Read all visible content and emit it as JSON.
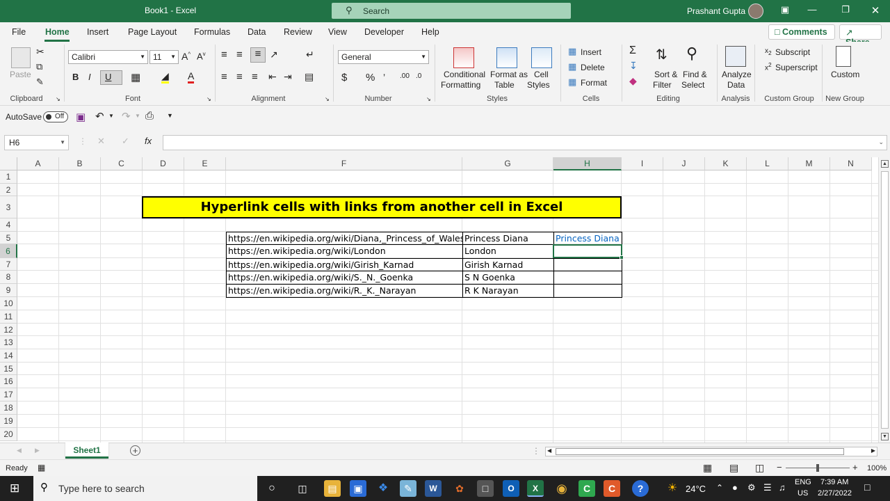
{
  "window": {
    "title": "Book1 - Excel",
    "search_label": "Search",
    "user_name": "Prashant Gupta"
  },
  "menu": {
    "items": [
      "File",
      "Home",
      "Insert",
      "Page Layout",
      "Formulas",
      "Data",
      "Review",
      "View",
      "Developer",
      "Help"
    ],
    "active": "Home",
    "comments": "Comments",
    "share": "Share"
  },
  "ribbon": {
    "clipboard": {
      "label": "Clipboard",
      "paste": "Paste"
    },
    "font": {
      "label": "Font",
      "name": "Calibri",
      "size": "11",
      "bold": "B",
      "italic": "I",
      "underline": "U"
    },
    "alignment": {
      "label": "Alignment"
    },
    "number": {
      "label": "Number",
      "format": "General"
    },
    "styles": {
      "label": "Styles",
      "cond1": "Conditional",
      "cond2": "Formatting",
      "fmt1": "Format as",
      "fmt2": "Table",
      "cell1": "Cell",
      "cell2": "Styles"
    },
    "cells": {
      "label": "Cells",
      "insert": "Insert",
      "delete": "Delete",
      "format": "Format"
    },
    "editing": {
      "label": "Editing",
      "sort1": "Sort &",
      "sort2": "Filter",
      "find1": "Find &",
      "find2": "Select"
    },
    "analysis": {
      "label": "Analysis",
      "analyze1": "Analyze",
      "analyze2": "Data"
    },
    "custom_group": {
      "label": "Custom Group",
      "subscript": "Subscript",
      "superscript": "Superscript"
    },
    "new_group": {
      "label": "New Group",
      "custom": "Custom"
    }
  },
  "qat": {
    "autosave": "AutoSave",
    "toggle": "Off"
  },
  "formula_bar": {
    "name_box": "H6",
    "formula": ""
  },
  "sheet": {
    "columns": [
      "A",
      "B",
      "C",
      "D",
      "E",
      "F",
      "G",
      "H",
      "I",
      "J",
      "K",
      "L",
      "M",
      "N"
    ],
    "selected_column": "H",
    "rows": [
      "1",
      "2",
      "3",
      "4",
      "5",
      "6",
      "7",
      "8",
      "9",
      "10",
      "11",
      "12",
      "13",
      "14",
      "15",
      "16",
      "17",
      "18",
      "19",
      "20"
    ],
    "selected_row": "6",
    "title": "Hyperlink cells with links from another cell in Excel",
    "table": [
      {
        "url": "https://en.wikipedia.org/wiki/Diana,_Princess_of_Wales",
        "name": "Princess Diana",
        "link": "Princess Diana"
      },
      {
        "url": "https://en.wikipedia.org/wiki/London",
        "name": "London",
        "link": ""
      },
      {
        "url": "https://en.wikipedia.org/wiki/Girish_Karnad",
        "name": "Girish Karnad",
        "link": ""
      },
      {
        "url": "https://en.wikipedia.org/wiki/S._N._Goenka",
        "name": "S N Goenka",
        "link": ""
      },
      {
        "url": "https://en.wikipedia.org/wiki/R._K._Narayan",
        "name": "R K Narayan",
        "link": ""
      }
    ],
    "tab_name": "Sheet1"
  },
  "status": {
    "text": "Ready",
    "zoom": "100%"
  },
  "taskbar": {
    "search_placeholder": "Type here to search",
    "temp": "24°C",
    "lang1": "ENG",
    "lang2": "US",
    "time": "7:39 AM",
    "date": "2/27/2022"
  },
  "colors": {
    "excel_green": "#217346",
    "title_fill": "#ffff00",
    "hyperlink": "#0563c1"
  }
}
